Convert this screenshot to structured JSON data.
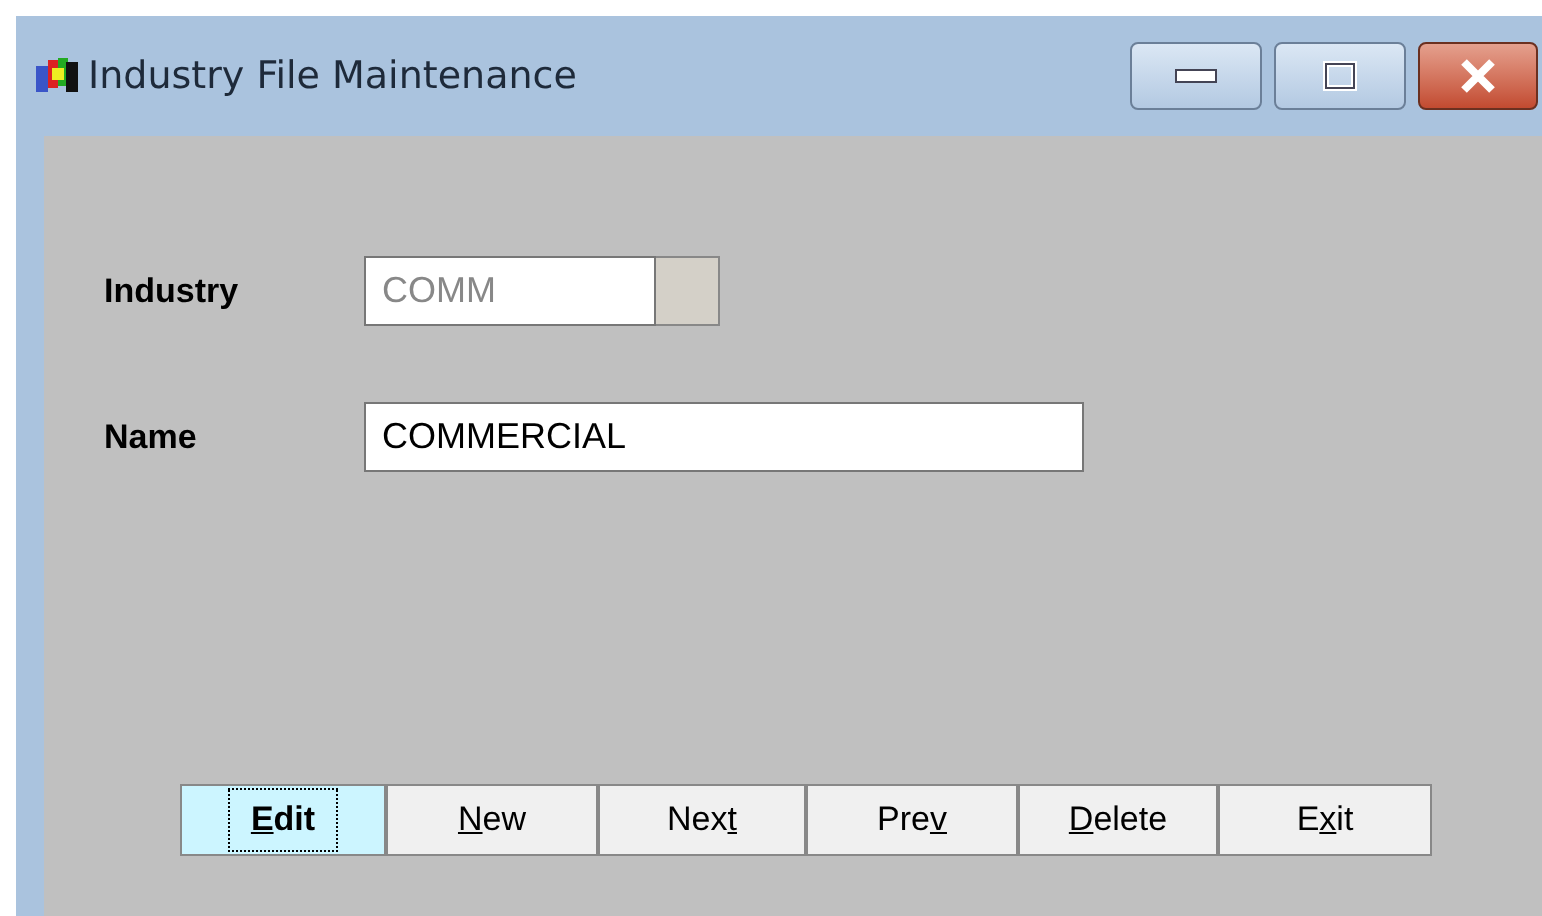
{
  "window": {
    "title": "Industry File Maintenance"
  },
  "fields": [
    {
      "label": "Industry",
      "value": "COMM",
      "disabled": true,
      "kind": "lookup"
    },
    {
      "label": "Name",
      "value": "COMMERCIAL",
      "disabled": false,
      "kind": "text"
    }
  ],
  "buttons": [
    {
      "access_key": "E",
      "label_end": "dit",
      "selected": true
    },
    {
      "access_key": "N",
      "label_end": "ew",
      "selected": false
    },
    {
      "label_start": "Nex",
      "access_key": "t",
      "selected": false
    },
    {
      "label_start": "Pre",
      "access_key": "v",
      "selected": false
    },
    {
      "access_key": "D",
      "label_end": "elete",
      "selected": false
    },
    {
      "label_start": "E",
      "access_key": "x",
      "label_end": "it",
      "selected": false
    }
  ]
}
